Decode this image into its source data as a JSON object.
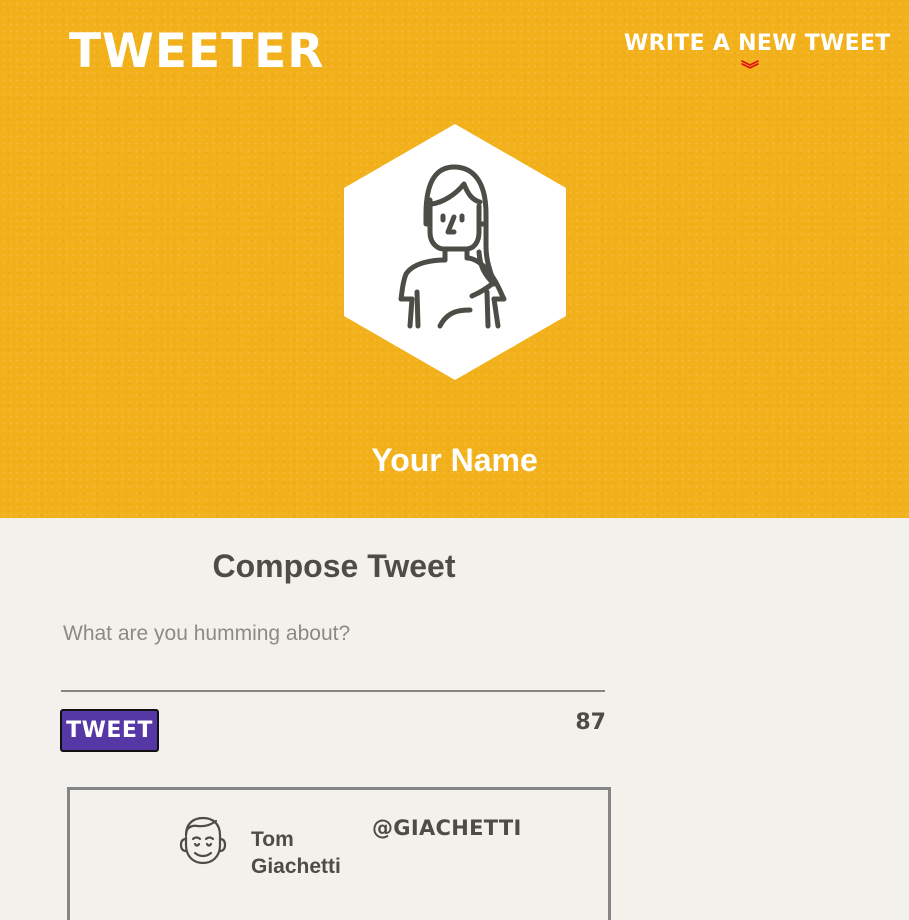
{
  "header": {
    "brand": "TWEETER",
    "write_link": "WRITE A NEW TWEET",
    "write_link_icon": "chevron-double-down-icon"
  },
  "profile": {
    "avatar_icon": "woman-avatar-icon",
    "name": "Your Name"
  },
  "compose": {
    "title": "Compose Tweet",
    "placeholder": "What are you humming about?",
    "value": "",
    "button_label": "TWEET",
    "char_count": "87"
  },
  "tweets": [
    {
      "avatar_icon": "man-avatar-icon",
      "name": "Tom Giachetti",
      "handle": "@GIACHETTI"
    }
  ],
  "colors": {
    "hero_bg": "#f2b01a",
    "page_bg": "#f3f1ec",
    "text": "#4d4c46",
    "button_bg": "#5538a6",
    "chevron": "#e01010",
    "border": "#858585"
  }
}
